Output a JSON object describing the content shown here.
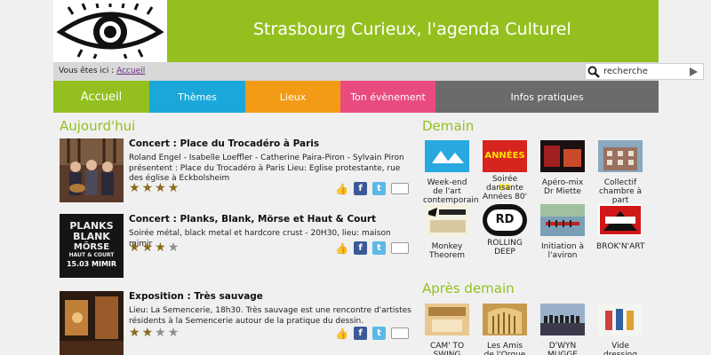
{
  "header": {
    "site_title": "Strasbourg Curieux, l'agenda Culturel"
  },
  "breadcrumb": {
    "prefix": "Vous êtes ici :",
    "link": "Accueil"
  },
  "search": {
    "placeholder": "recherche"
  },
  "nav": {
    "items": [
      "Accueil",
      "Thèmes",
      "Lieux",
      "Ton évènement",
      "Infos pratiques"
    ]
  },
  "today": {
    "heading": "Aujourd'hui",
    "events": [
      {
        "title": "Concert : Place du Trocadéro à Paris",
        "desc": "Roland Engel - Isabelle Loeffler - Catherine Paira-Piron - Sylvain Piron présentent : Place du Trocadéro à Paris Lieu: Eglise protestante, rue des église à Eckbolsheim",
        "rating": 4
      },
      {
        "title": "Concert : Planks, Blank, Mörse et Haut & Court",
        "desc": "Soirée métal, black metal et hardcore crust - 20H30, lieu: maison mimir",
        "rating": 3,
        "thumb_text": [
          "PLANKS",
          "BLANK",
          "MÖRSE",
          "HAUT & COURT",
          "15.03 MIMIR"
        ]
      },
      {
        "title": "Exposition : Très sauvage",
        "desc": "Lieu: La Semencerie, 18h30. Très sauvage est une rencontre d'artistes résidents à la Semencerie autour de la pratique du dessin.",
        "rating": 2
      }
    ]
  },
  "tomorrow": {
    "heading": "Demain",
    "tiles": [
      {
        "label": "Week-end de l'art contemporain"
      },
      {
        "label": "Soirée dansante Années 80'",
        "img_text": "ANNÉES 80"
      },
      {
        "label": "Apéro-mix Dr Miette"
      },
      {
        "label": "Collectif chambre à part"
      },
      {
        "label": "Monkey Theorem"
      },
      {
        "label": "ROLLING DEEP",
        "img_text": "RD"
      },
      {
        "label": "Initiation à l'aviron"
      },
      {
        "label": "BROK'N'ART"
      }
    ]
  },
  "after_tomorrow": {
    "heading": "Après demain",
    "tiles": [
      {
        "label": "CAM' TO SWING"
      },
      {
        "label": "Les Amis de l'Orgue"
      },
      {
        "label": "D'WYN MUGGE"
      },
      {
        "label": "Vide dressing"
      }
    ]
  },
  "colors": {
    "brand_green": "#93c01f",
    "nav_blue": "#1aa7d9",
    "nav_orange": "#f39b16",
    "nav_pink": "#ea4b7e",
    "nav_grey": "#6b6b6b"
  },
  "icons": {
    "logo": "eye-icon",
    "search": "search-icon",
    "share": [
      "like-icon",
      "facebook-icon",
      "twitter-icon",
      "mail-icon"
    ]
  }
}
